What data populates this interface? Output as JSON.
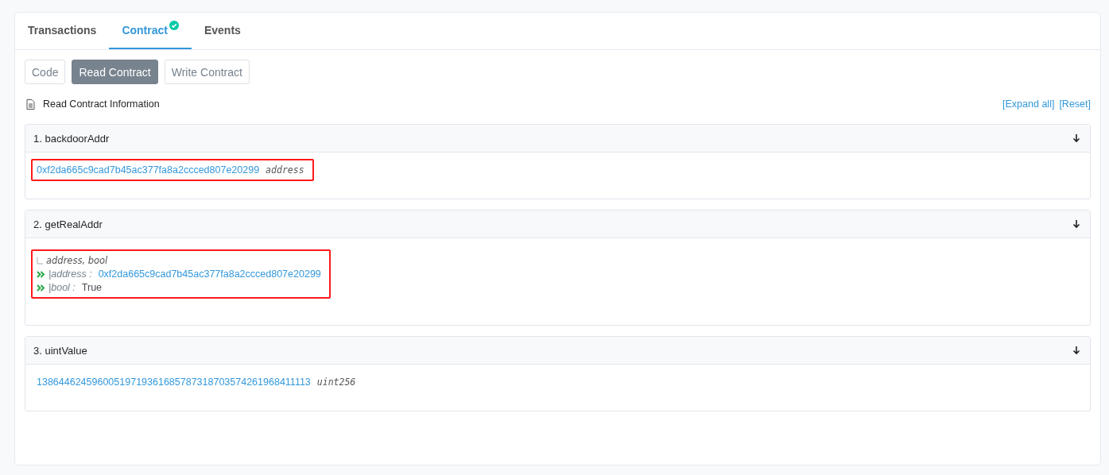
{
  "tabs": [
    {
      "label": "Transactions",
      "selected": false,
      "verified": false
    },
    {
      "label": "Contract",
      "selected": true,
      "verified": true
    },
    {
      "label": "Events",
      "selected": false,
      "verified": false
    }
  ],
  "subtabs": [
    {
      "label": "Code",
      "selected": false
    },
    {
      "label": "Read Contract",
      "selected": true
    },
    {
      "label": "Write Contract",
      "selected": false
    }
  ],
  "info": {
    "title": "Read Contract Information",
    "links": [
      "[Expand all]",
      "[Reset]"
    ]
  },
  "sections": [
    {
      "kind": "value",
      "title": "1. backdoorAddr",
      "highlighted": true,
      "value": "0xf2da665c9cad7b45ac377fa8a2ccced807e20299",
      "type": "address"
    },
    {
      "kind": "tuple",
      "title": "2. getRealAddr",
      "highlighted": true,
      "types": "address, bool",
      "outputs": [
        {
          "kind": "link",
          "name": "|address :",
          "value": "0xf2da665c9cad7b45ac377fa8a2ccced807e20299"
        },
        {
          "kind": "text",
          "name": "|bool :",
          "value": "True"
        }
      ]
    },
    {
      "kind": "value",
      "title": "3. uintValue",
      "highlighted": false,
      "value": "13864462459600519719361685787318703574261968411113",
      "type": "uint256"
    }
  ]
}
